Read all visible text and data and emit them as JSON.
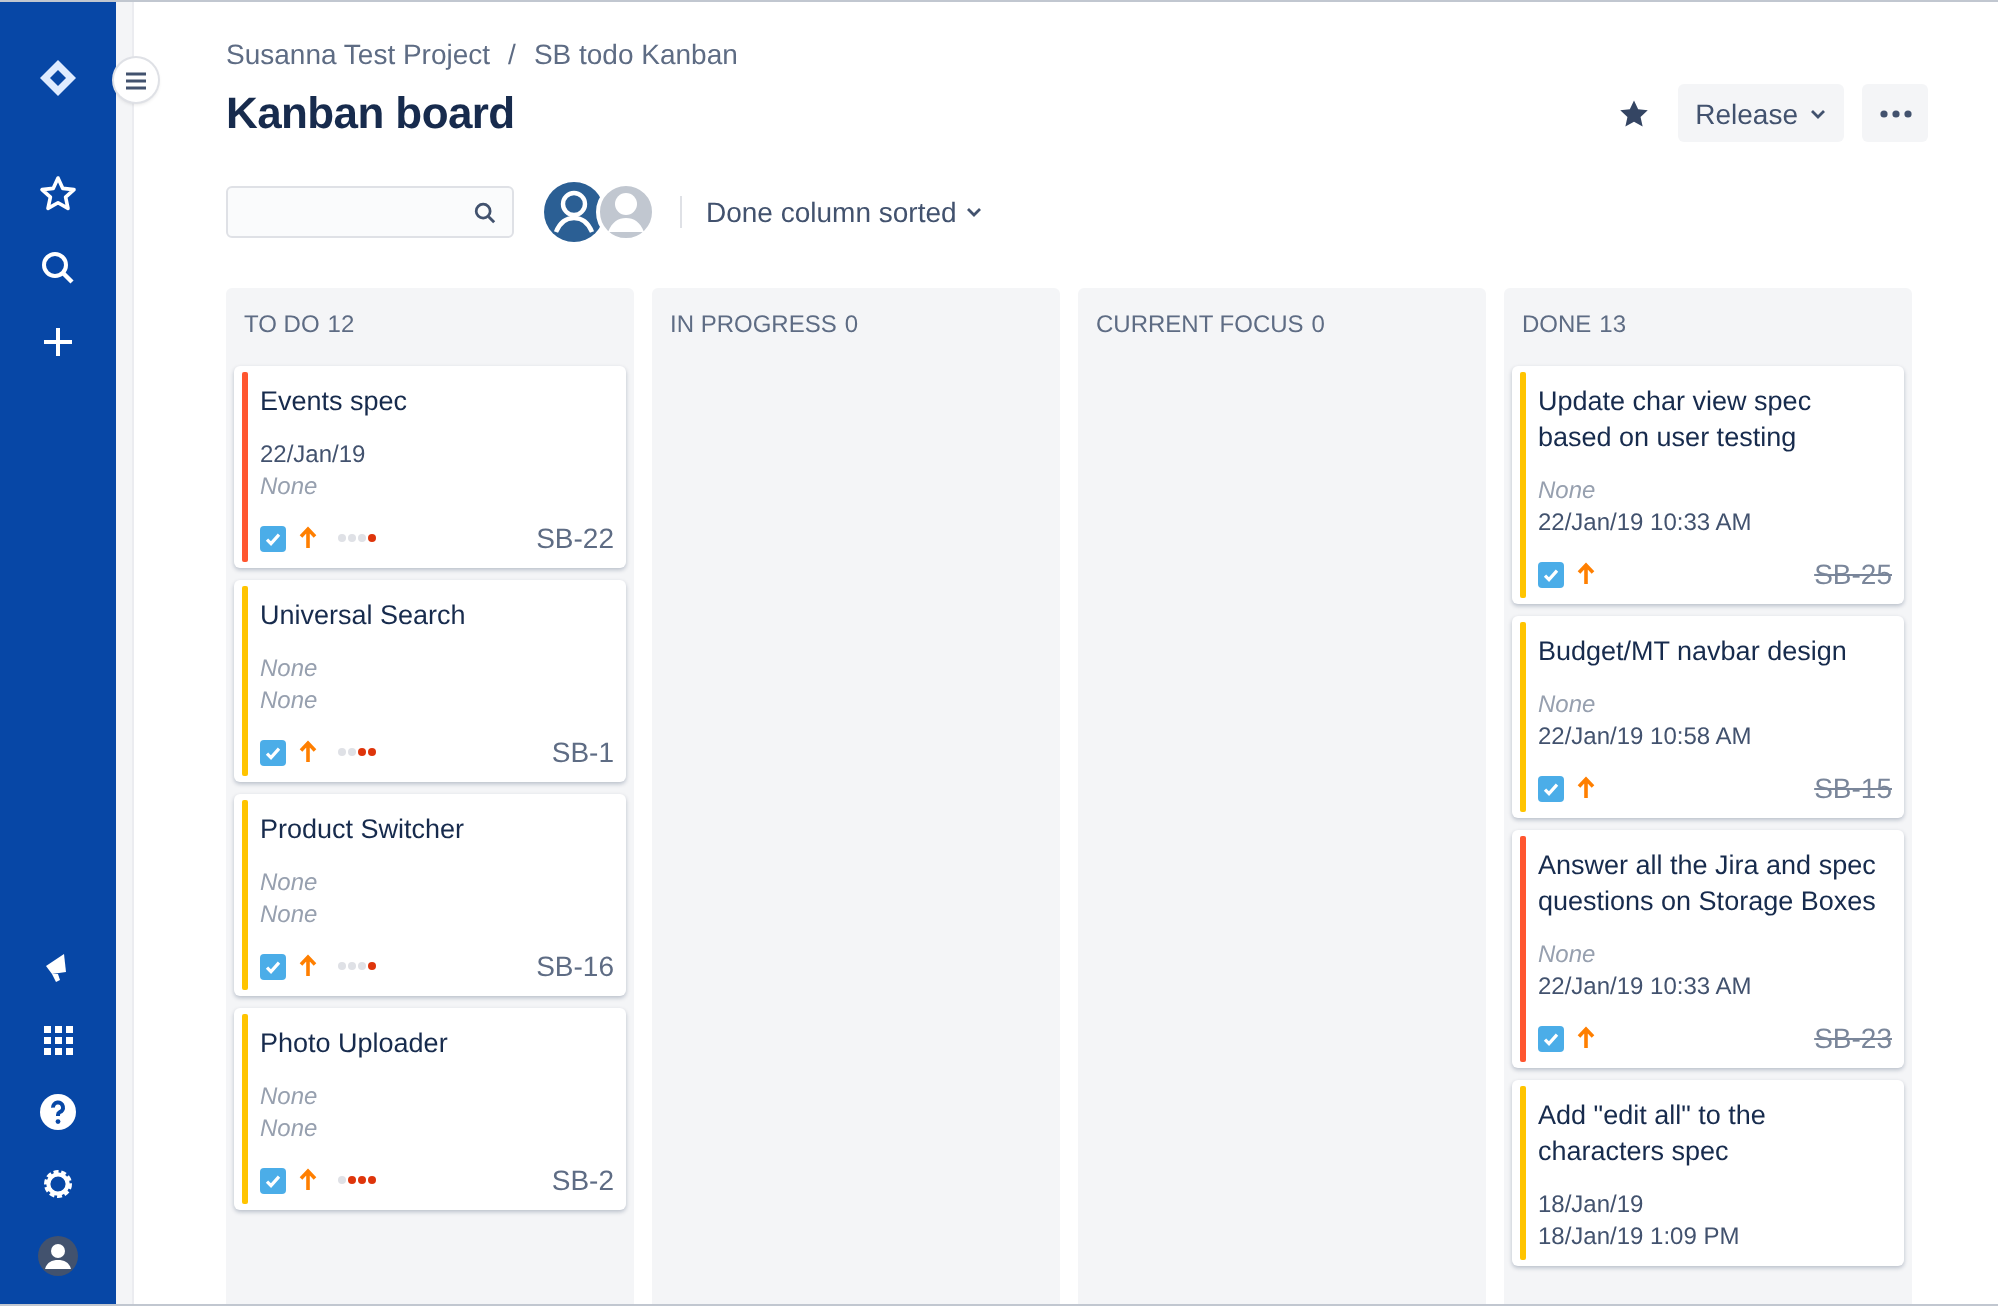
{
  "breadcrumbs": [
    "Susanna Test Project",
    "SB todo Kanban"
  ],
  "breadcrumb_separator": "/",
  "title": "Kanban board",
  "header_actions": {
    "release": "Release"
  },
  "toolbar": {
    "filter": "Done column sorted"
  },
  "columns": [
    {
      "name": "TO DO",
      "count": "12",
      "cards": [
        {
          "title": "Events spec",
          "lines": [
            {
              "text": "22/Jan/19",
              "empty": false
            },
            {
              "text": "None",
              "empty": true
            }
          ],
          "color": "#ff5630",
          "level": 0.25,
          "key": "SB-22",
          "resolved": false
        },
        {
          "title": "Universal Search",
          "lines": [
            {
              "text": "None",
              "empty": true
            },
            {
              "text": "None",
              "empty": true
            }
          ],
          "color": "#ffc400",
          "level": 0.5,
          "key": "SB-1",
          "resolved": false
        },
        {
          "title": "Product Switcher",
          "lines": [
            {
              "text": "None",
              "empty": true
            },
            {
              "text": "None",
              "empty": true
            }
          ],
          "color": "#ffc400",
          "level": 0.25,
          "key": "SB-16",
          "resolved": false
        },
        {
          "title": "Photo Uploader",
          "lines": [
            {
              "text": "None",
              "empty": true
            },
            {
              "text": "None",
              "empty": true
            }
          ],
          "color": "#ffc400",
          "level": 0.75,
          "key": "SB-2",
          "resolved": false
        }
      ]
    },
    {
      "name": "IN PROGRESS",
      "count": "0"
    },
    {
      "name": "CURRENT FOCUS",
      "count": "0"
    },
    {
      "name": "DONE",
      "count": "13",
      "cards": [
        {
          "title": "Update char view spec based on user testing",
          "lines": [
            {
              "text": "None",
              "empty": true
            },
            {
              "text": "22/Jan/19 10:33 AM",
              "empty": false
            }
          ],
          "color": "#ffc400",
          "key": "SB-25",
          "resolved": true
        },
        {
          "title": "Budget/MT navbar design",
          "lines": [
            {
              "text": "None",
              "empty": true
            },
            {
              "text": "22/Jan/19 10:58 AM",
              "empty": false
            }
          ],
          "color": "#ffc400",
          "key": "SB-15",
          "resolved": true
        },
        {
          "title": "Answer all the Jira and spec questions on Storage Boxes",
          "lines": [
            {
              "text": "None",
              "empty": true
            },
            {
              "text": "22/Jan/19 10:33 AM",
              "empty": false
            }
          ],
          "color": "#ff5630",
          "key": "SB-23",
          "resolved": true
        },
        {
          "title": "Add \"edit all\" to the characters spec",
          "lines": [
            {
              "text": "18/Jan/19",
              "empty": false
            },
            {
              "text": "18/Jan/19 1:09 PM",
              "empty": false
            }
          ],
          "color": "#ffc400"
        }
      ]
    }
  ]
}
